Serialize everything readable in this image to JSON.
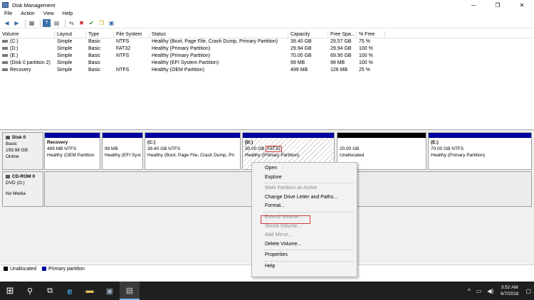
{
  "window": {
    "title": "Disk Management",
    "min": "─",
    "max": "❐",
    "close": "✕"
  },
  "menu": [
    "File",
    "Action",
    "View",
    "Help"
  ],
  "toolbar": {
    "back": "◀",
    "forward": "▶",
    "list": "▦",
    "help": "?",
    "props": "▤",
    "connect": "⇆",
    "delete": "✖",
    "check": "✔",
    "new": "❐",
    "explore": "▣"
  },
  "table": {
    "headers": [
      "Volume",
      "Layout",
      "Type",
      "File System",
      "Status",
      "Capacity",
      "Free Spa...",
      "% Free"
    ],
    "rows": [
      [
        "(C:)",
        "Simple",
        "Basic",
        "NTFS",
        "Healthy (Boot, Page File, Crash Dump, Primary Partition)",
        "39.40 GB",
        "29.57 GB",
        "75 %"
      ],
      [
        "(D:)",
        "Simple",
        "Basic",
        "FAT32",
        "Healthy (Primary Partition)",
        "29.94 GB",
        "29.94 GB",
        "100 %"
      ],
      [
        "(E:)",
        "Simple",
        "Basic",
        "NTFS",
        "Healthy (Primary Partition)",
        "70.00 GB",
        "69.90 GB",
        "100 %"
      ],
      [
        "(Disk 0 partition 2)",
        "Simple",
        "Basic",
        "",
        "Healthy (EFI System Partition)",
        "99 MB",
        "99 MB",
        "100 %"
      ],
      [
        "Recovery",
        "Simple",
        "Basic",
        "NTFS",
        "Healthy (OEM Partition)",
        "499 MB",
        "126 MB",
        "25 %"
      ]
    ]
  },
  "disk0": {
    "name": "Disk 0",
    "type": "Basic",
    "size": "159.98 GB",
    "state": "Online",
    "parts": {
      "recovery": {
        "name": "Recovery",
        "size": "499 MB NTFS",
        "status": "Healthy (OEM Partition"
      },
      "efi": {
        "size": "99 MB",
        "status": "Healthy (EFI Syst"
      },
      "c": {
        "name": "(C:)",
        "size": "39.40 GB NTFS",
        "status": "Healthy (Boot, Page File, Crash Dump, Pri"
      },
      "d": {
        "name": "(D:)",
        "size": "30.00 GB",
        "fs": "FAT32",
        "status": "Healthy (Primary Partition)"
      },
      "unalloc": {
        "size": "20.00 GB",
        "status": "Unallocated"
      },
      "e": {
        "name": "(E:)",
        "size": "70.00 GB NTFS",
        "status": "Healthy (Primary Partition)"
      }
    }
  },
  "cdrom": {
    "name": "CD-ROM 0",
    "type": "DVD (G:)",
    "state": "No Media"
  },
  "legend": {
    "unallocated": "Unallocated",
    "primary": "Primary partition"
  },
  "context_menu": {
    "open": "Open",
    "explore": "Explore",
    "mark_active": "Mark Partition as Active",
    "change_letter": "Change Drive Letter and Paths...",
    "format": "Format...",
    "extend": "Extend Volume...",
    "shrink": "Shrink Volume...",
    "mirror": "Add Mirror...",
    "delete": "Delete Volume...",
    "properties": "Properties",
    "help": "Help"
  },
  "taskbar": {
    "start": "⊞",
    "search": "⚲",
    "taskview": "⧉",
    "ie": "e",
    "explorer": "▬",
    "server": "▣",
    "diskmgmt": "▤",
    "chevron": "^",
    "network": "▭",
    "volume": "◀)",
    "time": "3:52 AM",
    "date": "6/7/2018",
    "notif": "▢"
  },
  "colors": {
    "primary": "#0000a0",
    "unallocated": "#000000",
    "highlight": "#d23a3a"
  }
}
